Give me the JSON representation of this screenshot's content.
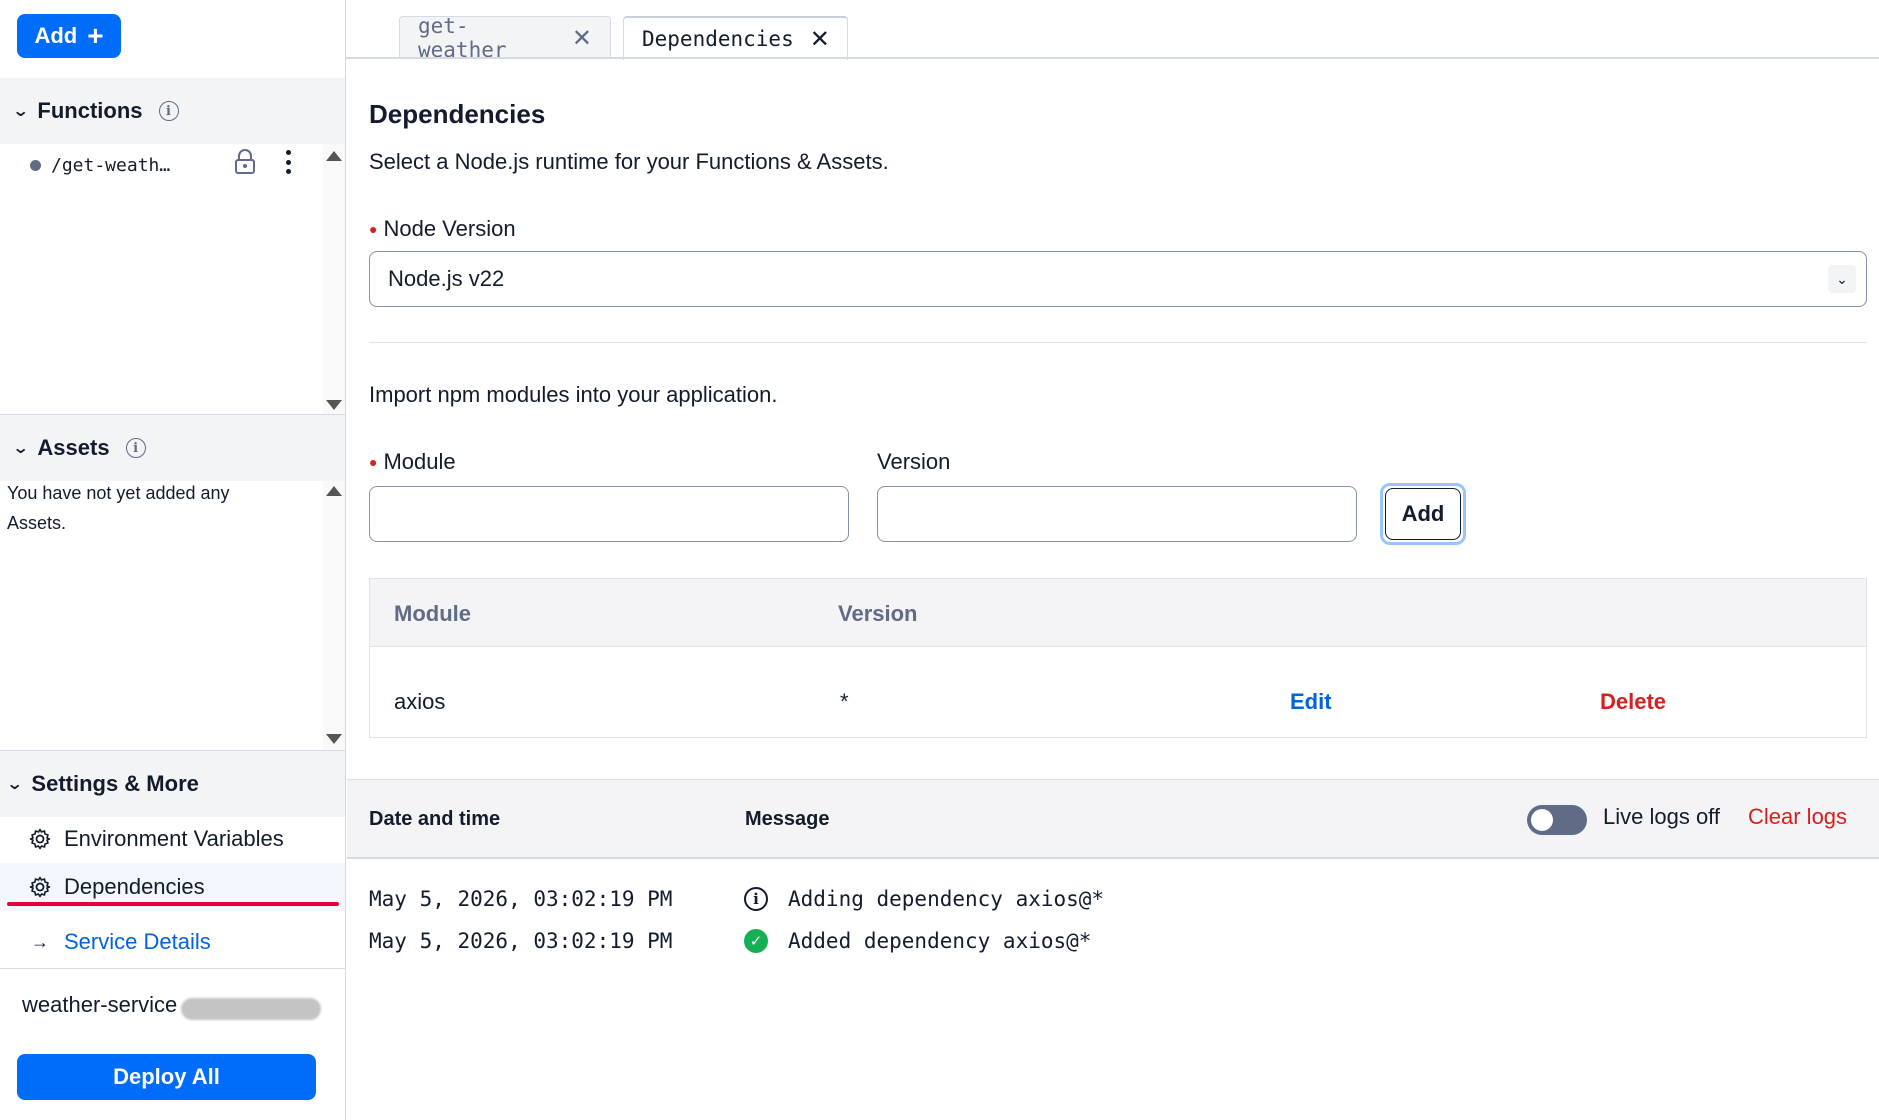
{
  "sidebar": {
    "add_label": "Add",
    "functions": {
      "title": "Functions",
      "items": [
        {
          "path": "/get-weath…"
        }
      ]
    },
    "assets": {
      "title": "Assets",
      "empty_text": "You have not yet added any Assets."
    },
    "settings": {
      "title": "Settings & More",
      "items": [
        {
          "label": "Environment Variables"
        },
        {
          "label": "Dependencies"
        },
        {
          "label": "Service Details"
        }
      ]
    },
    "service_name": "weather-service",
    "deploy_label": "Deploy All"
  },
  "tabs": [
    {
      "label": "get-weather"
    },
    {
      "label": "Dependencies"
    }
  ],
  "main": {
    "title": "Dependencies",
    "subtitle": "Select a Node.js runtime for your Functions & Assets.",
    "node_version": {
      "label": "Node Version",
      "value": "Node.js v22"
    },
    "import_text": "Import npm modules into your application.",
    "module_label": "Module",
    "version_label": "Version",
    "module_value": "",
    "version_value": "",
    "add_label": "Add",
    "table": {
      "headers": [
        "Module",
        "Version"
      ],
      "rows": [
        {
          "module": "axios",
          "version": "*",
          "edit": "Edit",
          "delete": "Delete"
        }
      ]
    }
  },
  "logs": {
    "col_time": "Date and time",
    "col_message": "Message",
    "live_label": "Live logs off",
    "live_enabled": false,
    "clear_label": "Clear logs",
    "entries": [
      {
        "time": "May 5, 2026, 03:02:19 PM",
        "level": "info",
        "message": "Adding dependency axios@*"
      },
      {
        "time": "May 5, 2026, 03:02:19 PM",
        "level": "success",
        "message": "Added dependency axios@*"
      }
    ]
  },
  "colors": {
    "primary": "#006dfa",
    "danger": "#d61f1f",
    "link": "#0263e0",
    "success": "#14b053",
    "active_underline": "#e4003b"
  }
}
